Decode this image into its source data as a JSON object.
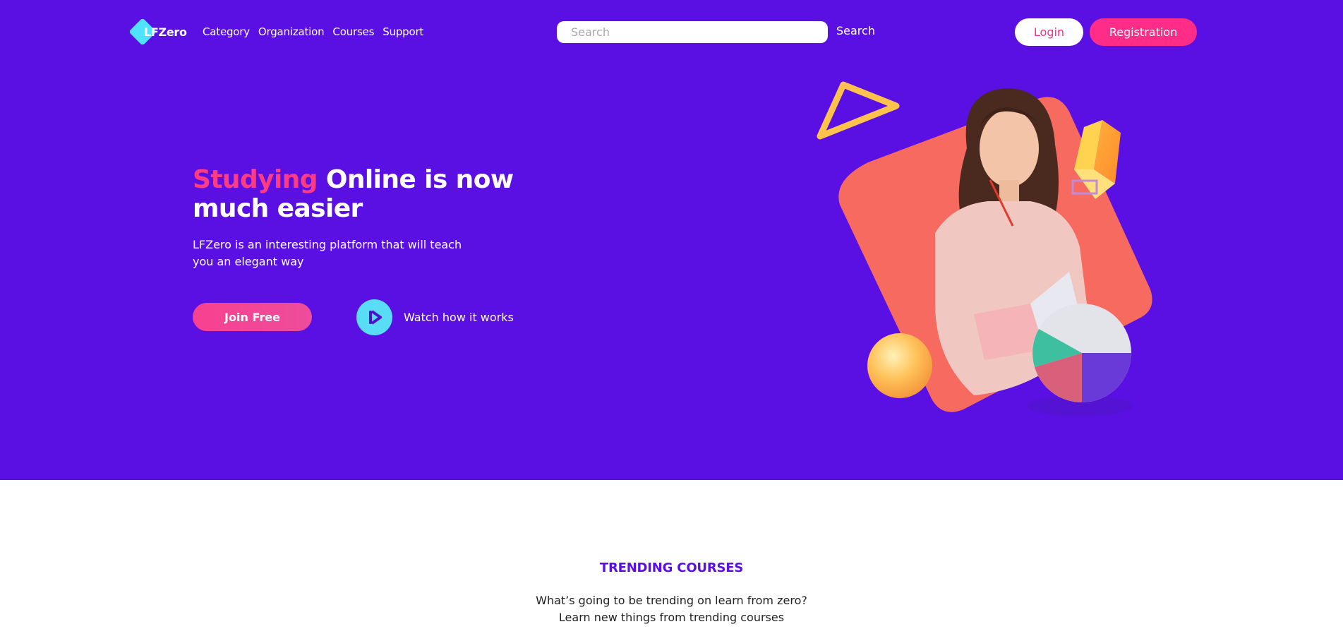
{
  "brand": {
    "logo_text": "LFZero"
  },
  "nav": {
    "items": [
      "Category",
      "Organization",
      "Courses",
      "Support"
    ]
  },
  "search": {
    "placeholder": "Search",
    "button_label": "Search"
  },
  "auth": {
    "login_label": "Login",
    "register_label": "Registration"
  },
  "hero": {
    "headline_accent": "Studying",
    "headline_rest": " Online is now much easier",
    "subtext": "LFZero is an interesting platform that will teach you an elegant way",
    "join_label": "Join Free",
    "watch_label": "Watch how it works",
    "icons": {
      "play": "play-icon"
    }
  },
  "trending": {
    "title": "TRENDING COURSES",
    "subtitle_line1": "What’s going to be trending on learn from zero?",
    "subtitle_line2": "Learn new things from trending courses"
  },
  "colors": {
    "hero_bg": "#5a0fe3",
    "accent_pink": "#ff2d87",
    "accent_cyan": "#59ddf7",
    "illustration_coral": "#f76a5f",
    "text_dark": "#222222"
  }
}
